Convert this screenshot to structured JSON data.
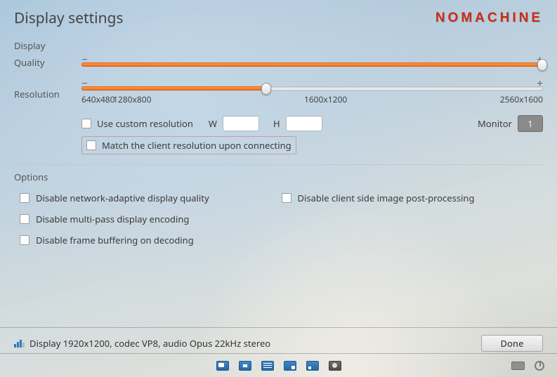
{
  "header": {
    "title": "Display settings",
    "brand": "NOMACHINE"
  },
  "sections": {
    "display": "Display",
    "options": "Options"
  },
  "quality": {
    "label": "Quality",
    "minus": "−",
    "plus": "+",
    "percent": 100
  },
  "resolution": {
    "label": "Resolution",
    "minus": "−",
    "plus": "+",
    "ticks": [
      "640x480",
      "1280x800",
      "1600x1200",
      "2560x1600"
    ],
    "percent": 40
  },
  "custom": {
    "label": "Use custom resolution",
    "w": "W",
    "h": "H",
    "w_value": "",
    "h_value": ""
  },
  "monitor": {
    "label": "Monitor",
    "value": "1"
  },
  "match": {
    "label": "Match the client resolution upon connecting"
  },
  "options": {
    "o1": "Disable network-adaptive display quality",
    "o2": "Disable client side image post-processing",
    "o3": "Disable multi-pass display encoding",
    "o4": "Disable frame buffering on decoding"
  },
  "status": {
    "text": "Display 1920x1200, codec VP8, audio Opus 22kHz stereo"
  },
  "footer": {
    "done": "Done"
  }
}
